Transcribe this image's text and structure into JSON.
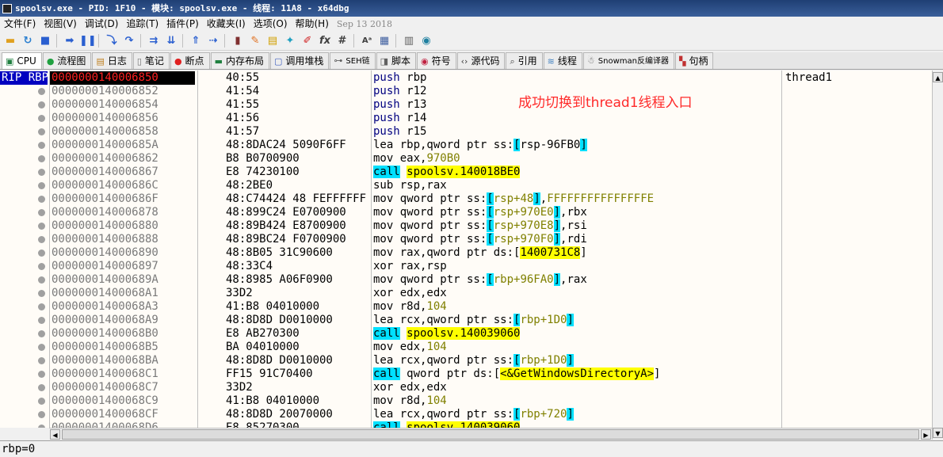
{
  "window": {
    "title": "spoolsv.exe - PID: 1F10 - 模块: spoolsv.exe - 线程: 11A8 - x64dbg"
  },
  "menu": [
    "文件(F)",
    "视图(V)",
    "调试(D)",
    "追踪(T)",
    "插件(P)",
    "收藏夹(I)",
    "选项(O)",
    "帮助(H)"
  ],
  "menu_date": "Sep 13 2018",
  "tabs": [
    {
      "label": "CPU",
      "icon": "cpu-icon"
    },
    {
      "label": "流程图",
      "icon": "graph-icon"
    },
    {
      "label": "日志",
      "icon": "log-icon"
    },
    {
      "label": "笔记",
      "icon": "notes-icon"
    },
    {
      "label": "断点",
      "icon": "breakpoint-icon"
    },
    {
      "label": "内存布局",
      "icon": "memory-map-icon"
    },
    {
      "label": "调用堆栈",
      "icon": "call-stack-icon"
    },
    {
      "label": "SEH链",
      "icon": "seh-icon"
    },
    {
      "label": "脚本",
      "icon": "script-icon"
    },
    {
      "label": "符号",
      "icon": "symbols-icon"
    },
    {
      "label": "源代码",
      "icon": "source-icon"
    },
    {
      "label": "引用",
      "icon": "references-icon"
    },
    {
      "label": "线程",
      "icon": "threads-icon"
    },
    {
      "label": "Snowman反编译器",
      "icon": "snowman-icon"
    },
    {
      "label": "句柄",
      "icon": "handles-icon"
    }
  ],
  "rip_label": "RIP RBP",
  "thread_label": "thread1",
  "annotation": "成功切换到thread1线程入口",
  "status_text": "rbp=0",
  "disasm": [
    {
      "addr": "0000000140006850",
      "bytes": "40:55",
      "parts": [
        [
          "push",
          "mn-push"
        ],
        [
          " rbp",
          ""
        ]
      ],
      "current": true
    },
    {
      "addr": "0000000140006852",
      "bytes": "41:54",
      "parts": [
        [
          "push",
          "mn-push"
        ],
        [
          " r12",
          ""
        ]
      ]
    },
    {
      "addr": "0000000140006854",
      "bytes": "41:55",
      "parts": [
        [
          "push",
          "mn-push"
        ],
        [
          " r13",
          ""
        ]
      ]
    },
    {
      "addr": "0000000140006856",
      "bytes": "41:56",
      "parts": [
        [
          "push",
          "mn-push"
        ],
        [
          " r14",
          ""
        ]
      ]
    },
    {
      "addr": "0000000140006858",
      "bytes": "41:57",
      "parts": [
        [
          "push",
          "mn-push"
        ],
        [
          " r15",
          ""
        ]
      ]
    },
    {
      "addr": "000000014000685A",
      "bytes": "48:8DAC24 5090F6FF",
      "parts": [
        [
          "lea rbp,qword ptr ss:",
          ""
        ],
        [
          "[",
          "bk"
        ],
        [
          "rsp-96FB0",
          ""
        ],
        [
          "]",
          "bk"
        ]
      ]
    },
    {
      "addr": "0000000140006862",
      "bytes": "B8 B0700900",
      "parts": [
        [
          "mov eax,",
          ""
        ],
        [
          "970B0",
          "num"
        ]
      ]
    },
    {
      "addr": "0000000140006867",
      "bytes": "E8 74230100",
      "parts": [
        [
          "call",
          "mn-call"
        ],
        [
          " ",
          ""
        ],
        [
          "spoolsv.140018BE0",
          "tgt"
        ]
      ]
    },
    {
      "addr": "000000014000686C",
      "bytes": "48:2BE0",
      "parts": [
        [
          "sub rsp,rax",
          ""
        ]
      ]
    },
    {
      "addr": "000000014000686F",
      "bytes": "48:C74424 48 FEFFFFFF",
      "parts": [
        [
          "mov qword ptr ss:",
          ""
        ],
        [
          "[",
          "bk"
        ],
        [
          "rsp+48",
          "num"
        ],
        [
          "]",
          "bk"
        ],
        [
          ",",
          ""
        ],
        [
          "FFFFFFFFFFFFFFFE",
          "num"
        ]
      ]
    },
    {
      "addr": "0000000140006878",
      "bytes": "48:899C24 E0700900",
      "parts": [
        [
          "mov qword ptr ss:",
          ""
        ],
        [
          "[",
          "bk"
        ],
        [
          "rsp+970E0",
          "num"
        ],
        [
          "]",
          "bk"
        ],
        [
          ",rbx",
          ""
        ]
      ]
    },
    {
      "addr": "0000000140006880",
      "bytes": "48:89B424 E8700900",
      "parts": [
        [
          "mov qword ptr ss:",
          ""
        ],
        [
          "[",
          "bk"
        ],
        [
          "rsp+970E8",
          "num"
        ],
        [
          "]",
          "bk"
        ],
        [
          ",rsi",
          ""
        ]
      ]
    },
    {
      "addr": "0000000140006888",
      "bytes": "48:89BC24 F0700900",
      "parts": [
        [
          "mov qword ptr ss:",
          ""
        ],
        [
          "[",
          "bk"
        ],
        [
          "rsp+970F0",
          "num"
        ],
        [
          "]",
          "bk"
        ],
        [
          ",rdi",
          ""
        ]
      ]
    },
    {
      "addr": "0000000140006890",
      "bytes": "48:8B05 31C90600",
      "parts": [
        [
          "mov rax,qword ptr ds:[",
          ""
        ],
        [
          "1400731C8",
          "imm"
        ],
        [
          "]",
          ""
        ]
      ]
    },
    {
      "addr": "0000000140006897",
      "bytes": "48:33C4",
      "parts": [
        [
          "xor rax,rsp",
          ""
        ]
      ]
    },
    {
      "addr": "000000014000689A",
      "bytes": "48:8985 A06F0900",
      "parts": [
        [
          "mov qword ptr ss:",
          ""
        ],
        [
          "[",
          "bk"
        ],
        [
          "rbp+96FA0",
          "num"
        ],
        [
          "]",
          "bk"
        ],
        [
          ",rax",
          ""
        ]
      ]
    },
    {
      "addr": "00000001400068A1",
      "bytes": "33D2",
      "parts": [
        [
          "xor edx,edx",
          ""
        ]
      ]
    },
    {
      "addr": "00000001400068A3",
      "bytes": "41:B8 04010000",
      "parts": [
        [
          "mov r8d,",
          ""
        ],
        [
          "104",
          "num"
        ]
      ]
    },
    {
      "addr": "00000001400068A9",
      "bytes": "48:8D8D D0010000",
      "parts": [
        [
          "lea rcx,qword ptr ss:",
          ""
        ],
        [
          "[",
          "bk"
        ],
        [
          "rbp+1D0",
          "num"
        ],
        [
          "]",
          "bk"
        ]
      ]
    },
    {
      "addr": "00000001400068B0",
      "bytes": "E8 AB270300",
      "parts": [
        [
          "call",
          "mn-call"
        ],
        [
          " ",
          ""
        ],
        [
          "spoolsv.140039060",
          "tgt"
        ]
      ]
    },
    {
      "addr": "00000001400068B5",
      "bytes": "BA 04010000",
      "parts": [
        [
          "mov edx,",
          ""
        ],
        [
          "104",
          "num"
        ]
      ]
    },
    {
      "addr": "00000001400068BA",
      "bytes": "48:8D8D D0010000",
      "parts": [
        [
          "lea rcx,qword ptr ss:",
          ""
        ],
        [
          "[",
          "bk"
        ],
        [
          "rbp+1D0",
          "num"
        ],
        [
          "]",
          "bk"
        ]
      ]
    },
    {
      "addr": "00000001400068C1",
      "bytes": "FF15 91C70400",
      "parts": [
        [
          "call",
          "mn-call"
        ],
        [
          " qword ptr ds:[",
          ""
        ],
        [
          "<&GetWindowsDirectoryA>",
          "tgt"
        ],
        [
          "]",
          ""
        ]
      ]
    },
    {
      "addr": "00000001400068C7",
      "bytes": "33D2",
      "parts": [
        [
          "xor edx,edx",
          ""
        ]
      ]
    },
    {
      "addr": "00000001400068C9",
      "bytes": "41:B8 04010000",
      "parts": [
        [
          "mov r8d,",
          ""
        ],
        [
          "104",
          "num"
        ]
      ]
    },
    {
      "addr": "00000001400068CF",
      "bytes": "48:8D8D 20070000",
      "parts": [
        [
          "lea rcx,qword ptr ss:",
          ""
        ],
        [
          "[",
          "bk"
        ],
        [
          "rbp+720",
          "num"
        ],
        [
          "]",
          "bk"
        ]
      ]
    },
    {
      "addr": "00000001400068D6",
      "bytes": "E8 85270300",
      "parts": [
        [
          "call",
          "mn-call"
        ],
        [
          " ",
          ""
        ],
        [
          "spoolsv.140039060",
          "tgt"
        ]
      ]
    }
  ]
}
